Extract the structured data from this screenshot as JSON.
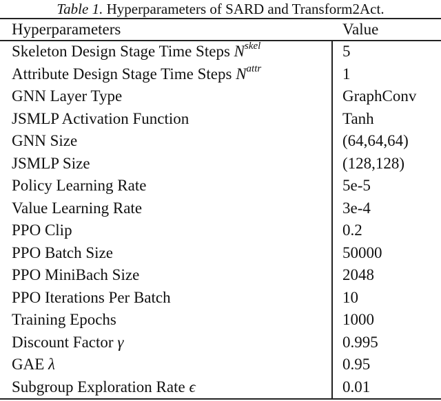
{
  "caption": {
    "label": "Table 1.",
    "text": " Hyperparameters of SARD and Transform2Act."
  },
  "table": {
    "headers": {
      "name": "Hyperparameters",
      "value": "Value"
    },
    "rows": [
      {
        "name": "Skeleton Design Stage Time Steps ",
        "symbol": "N",
        "sup": "skel",
        "value": "5"
      },
      {
        "name": "Attribute Design Stage Time Steps ",
        "symbol": "N",
        "sup": "attr",
        "value": "1"
      },
      {
        "name": "GNN Layer Type",
        "symbol": "",
        "sup": "",
        "value": "GraphConv"
      },
      {
        "name": "JSMLP Activation Function",
        "symbol": "",
        "sup": "",
        "value": "Tanh"
      },
      {
        "name": "GNN Size",
        "symbol": "",
        "sup": "",
        "value": "(64,64,64)"
      },
      {
        "name": "JSMLP Size",
        "symbol": "",
        "sup": "",
        "value": "(128,128)"
      },
      {
        "name": "Policy Learning Rate",
        "symbol": "",
        "sup": "",
        "value": "5e-5"
      },
      {
        "name": "Value Learning Rate",
        "symbol": "",
        "sup": "",
        "value": "3e-4"
      },
      {
        "name": "PPO Clip",
        "symbol": "",
        "sup": "",
        "value": "0.2"
      },
      {
        "name": "PPO Batch Size",
        "symbol": "",
        "sup": "",
        "value": "50000"
      },
      {
        "name": "PPO MiniBach Size",
        "symbol": "",
        "sup": "",
        "value": "2048"
      },
      {
        "name": "PPO Iterations Per Batch",
        "symbol": "",
        "sup": "",
        "value": "10"
      },
      {
        "name": "Training Epochs",
        "symbol": "",
        "sup": "",
        "value": "1000"
      },
      {
        "name": "Discount Factor ",
        "symbol": "γ",
        "sup": "",
        "value": "0.995"
      },
      {
        "name": "GAE ",
        "symbol": "λ",
        "sup": "",
        "value": "0.95"
      },
      {
        "name": "Subgroup Exploration Rate ",
        "symbol": "ϵ",
        "sup": "",
        "value": "0.01"
      }
    ]
  }
}
